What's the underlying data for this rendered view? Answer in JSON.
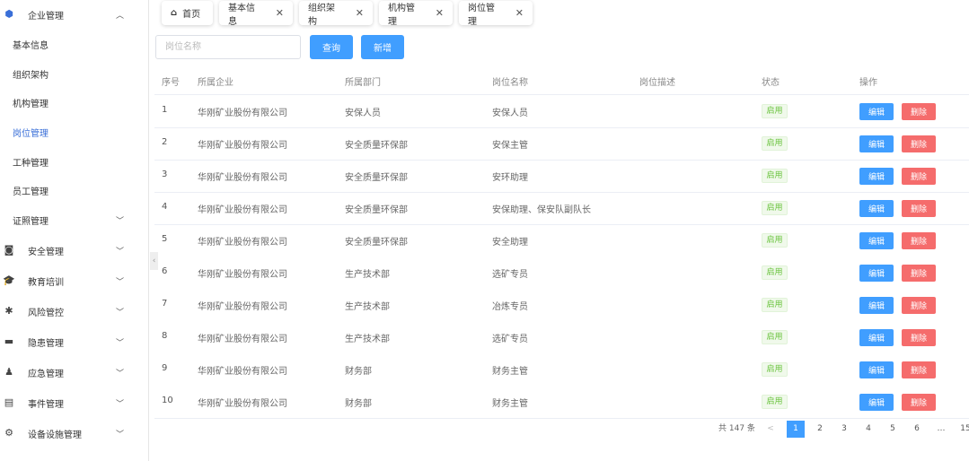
{
  "sidebar": {
    "items": [
      {
        "label": "企业管理",
        "icon": "enterprise-icon",
        "expanded": true
      },
      {
        "label": "基本信息",
        "sub": true
      },
      {
        "label": "组织架构",
        "sub": true
      },
      {
        "label": "机构管理",
        "sub": true
      },
      {
        "label": "岗位管理",
        "sub": true,
        "active": true
      },
      {
        "label": "工种管理",
        "sub": true
      },
      {
        "label": "员工管理",
        "sub": true
      },
      {
        "label": "证照管理",
        "sub": true,
        "chevron": true
      },
      {
        "label": "安全管理",
        "icon": "camera-icon",
        "chevron": true
      },
      {
        "label": "教育培训",
        "icon": "graduation-cap-icon",
        "chevron": true
      },
      {
        "label": "风险管控",
        "icon": "risk-icon",
        "chevron": true
      },
      {
        "label": "隐患管理",
        "icon": "hazard-icon",
        "chevron": true
      },
      {
        "label": "应急管理",
        "icon": "emergency-icon",
        "chevron": true
      },
      {
        "label": "事件管理",
        "icon": "event-icon",
        "chevron": true
      },
      {
        "label": "设备设施管理",
        "icon": "gear-icon",
        "chevron": true
      }
    ]
  },
  "tabs": [
    {
      "label": "首页",
      "home": true
    },
    {
      "label": "基本信息"
    },
    {
      "label": "组织架构"
    },
    {
      "label": "机构管理"
    },
    {
      "label": "岗位管理"
    }
  ],
  "toolbar": {
    "search_placeholder": "岗位名称",
    "query": "查询",
    "add": "新增"
  },
  "table": {
    "headers": [
      "序号",
      "所属企业",
      "所属部门",
      "岗位名称",
      "岗位描述",
      "状态",
      "操作"
    ],
    "rows": [
      [
        "1",
        "华刚矿业股份有限公司",
        "安保人员",
        "安保人员",
        "",
        "启用"
      ],
      [
        "2",
        "华刚矿业股份有限公司",
        "安全质量环保部",
        "安保主管",
        "",
        "启用"
      ],
      [
        "3",
        "华刚矿业股份有限公司",
        "安全质量环保部",
        "安环助理",
        "",
        "启用"
      ],
      [
        "4",
        "华刚矿业股份有限公司",
        "安全质量环保部",
        "安保助理、保安队副队长",
        "",
        "启用"
      ],
      [
        "5",
        "华刚矿业股份有限公司",
        "安全质量环保部",
        "安全助理",
        "",
        "启用"
      ],
      [
        "6",
        "华刚矿业股份有限公司",
        "生产技术部",
        "选矿专员",
        "",
        "启用"
      ],
      [
        "7",
        "华刚矿业股份有限公司",
        "生产技术部",
        "冶炼专员",
        "",
        "启用"
      ],
      [
        "8",
        "华刚矿业股份有限公司",
        "生产技术部",
        "选矿专员",
        "",
        "启用"
      ],
      [
        "9",
        "华刚矿业股份有限公司",
        "财务部",
        "财务主管",
        "",
        "启用"
      ],
      [
        "10",
        "华刚矿业股份有限公司",
        "财务部",
        "财务主管",
        "",
        "启用"
      ]
    ],
    "edit": "编辑",
    "delete": "删除"
  },
  "pagination": {
    "total": "共 147 条",
    "prev": "<",
    "pages": [
      "1",
      "2",
      "3",
      "4",
      "5",
      "6",
      "…",
      "15"
    ],
    "current": "1"
  },
  "colors": {
    "primary": "#409eff",
    "danger": "#f56c6c",
    "success": "#67c23a"
  }
}
